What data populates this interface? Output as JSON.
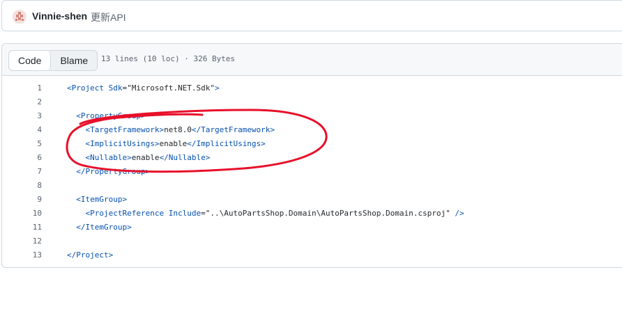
{
  "commit": {
    "author": "Vinnie-shen",
    "message": "更新API"
  },
  "file_header": {
    "tabs": [
      {
        "label": "Code",
        "active": true
      },
      {
        "label": "Blame",
        "active": false
      }
    ],
    "stats": "13 lines (10 loc) · 326 Bytes"
  },
  "code_lines": [
    {
      "n": "1",
      "indent": "",
      "parts": [
        [
          "tag",
          "<Project "
        ],
        [
          "attr",
          "Sdk"
        ],
        [
          "str",
          "=\"Microsoft.NET.Sdk\""
        ],
        [
          "tag",
          ">"
        ]
      ]
    },
    {
      "n": "2",
      "indent": "",
      "parts": []
    },
    {
      "n": "3",
      "indent": "  ",
      "parts": [
        [
          "tag",
          "<PropertyGroup>"
        ]
      ]
    },
    {
      "n": "4",
      "indent": "    ",
      "parts": [
        [
          "tag",
          "<TargetFramework>"
        ],
        [
          "str",
          "net8.0"
        ],
        [
          "tag",
          "</TargetFramework>"
        ]
      ]
    },
    {
      "n": "5",
      "indent": "    ",
      "parts": [
        [
          "tag",
          "<ImplicitUsings>"
        ],
        [
          "str",
          "enable"
        ],
        [
          "tag",
          "</ImplicitUsings>"
        ]
      ]
    },
    {
      "n": "6",
      "indent": "    ",
      "parts": [
        [
          "tag",
          "<Nullable>"
        ],
        [
          "str",
          "enable"
        ],
        [
          "tag",
          "</Nullable>"
        ]
      ]
    },
    {
      "n": "7",
      "indent": "  ",
      "parts": [
        [
          "tag",
          "</PropertyGroup>"
        ]
      ]
    },
    {
      "n": "8",
      "indent": "",
      "parts": []
    },
    {
      "n": "9",
      "indent": "  ",
      "parts": [
        [
          "tag",
          "<ItemGroup>"
        ]
      ]
    },
    {
      "n": "10",
      "indent": "    ",
      "parts": [
        [
          "tag",
          "<ProjectReference "
        ],
        [
          "attr",
          "Include"
        ],
        [
          "str",
          "=\"..\\AutoPartsShop.Domain\\AutoPartsShop.Domain.csproj\" "
        ],
        [
          "tag",
          "/>"
        ]
      ]
    },
    {
      "n": "11",
      "indent": "  ",
      "parts": [
        [
          "tag",
          "</ItemGroup>"
        ]
      ]
    },
    {
      "n": "12",
      "indent": "",
      "parts": []
    },
    {
      "n": "13",
      "indent": "",
      "parts": [
        [
          "tag",
          "</Project>"
        ]
      ]
    }
  ],
  "colors": {
    "tag": "#0550ae",
    "annotation": "#e8102a"
  }
}
